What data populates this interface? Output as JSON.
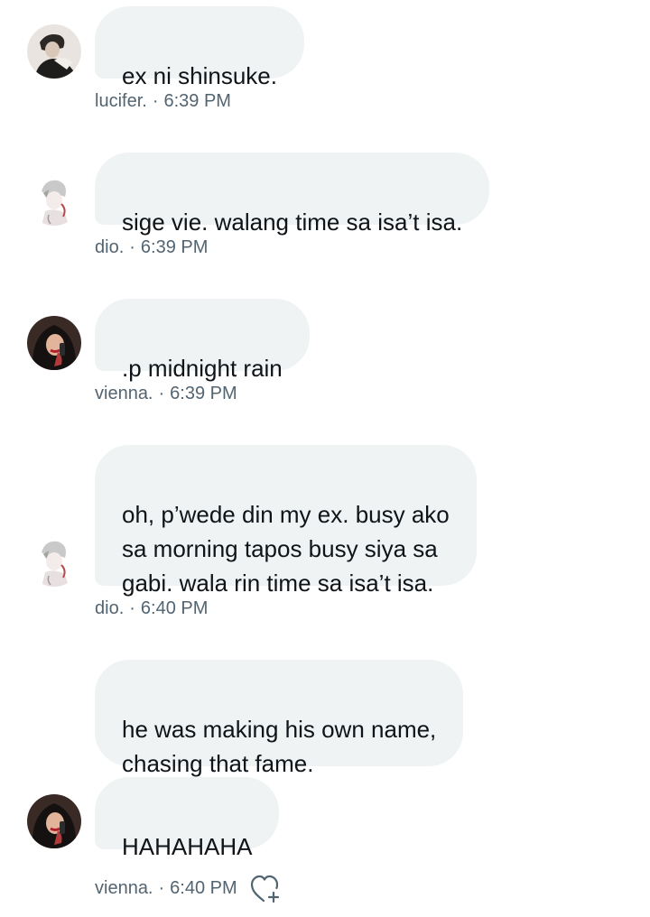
{
  "messages": [
    {
      "text": "ex ni shinsuke.",
      "sender": "lucifer.",
      "time": "6:39 PM",
      "separator": "·"
    },
    {
      "text": "sige vie. walang time sa isa’t isa.",
      "sender": "dio.",
      "time": "6:39 PM",
      "separator": "·"
    },
    {
      "text": ".p midnight rain",
      "sender": "vienna.",
      "time": "6:39 PM",
      "separator": "·"
    },
    {
      "text": "oh, p’wede din my ex. busy ako\nsa morning tapos busy siya sa\ngabi. wala rin time sa isa’t isa.",
      "sender": "dio.",
      "time": "6:40 PM",
      "separator": "·"
    },
    {
      "text": "he was making his own name,\nchasing that fame."
    },
    {
      "text": "HAHAHAHA",
      "sender": "vienna.",
      "time": "6:40 PM",
      "separator": "·"
    }
  ],
  "icons": {
    "reaction": "heart-plus-icon"
  },
  "colors": {
    "bubble": "#eff3f4",
    "text": "#0f1419",
    "meta": "#536471"
  }
}
